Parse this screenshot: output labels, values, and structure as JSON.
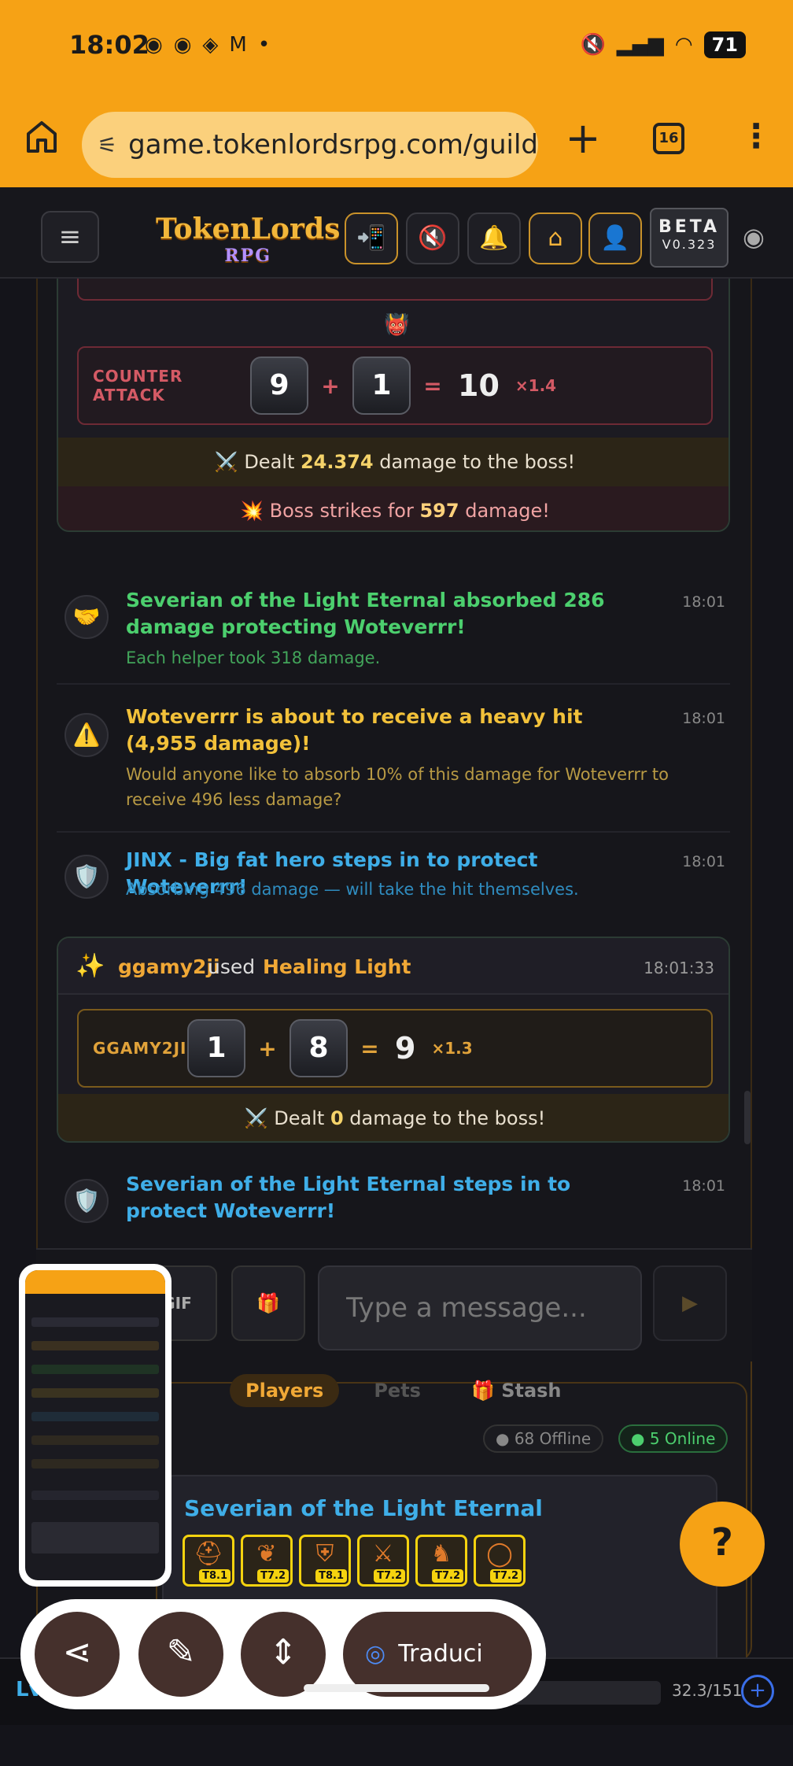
{
  "status": {
    "time": "18:02",
    "battery": "71"
  },
  "browser": {
    "url": "game.tokenlordsrpg.com/guilds",
    "tab_count": "16"
  },
  "header": {
    "logo_top": "TokenLords",
    "logo_bottom": "RPG",
    "beta_label": "BETA",
    "version": "V0.323"
  },
  "chat": {
    "attack_card": {
      "roll_label": "COUNTER ATTACK",
      "die1": "9",
      "die2": "1",
      "plus": "+",
      "equals": "=",
      "total": "10",
      "multiplier": "×1.4",
      "dealt_prefix": "⚔️ Dealt ",
      "dealt_value": "24.374",
      "dealt_suffix": " damage to the boss!",
      "boss_prefix": "💥 Boss strikes for ",
      "boss_value": "597",
      "boss_suffix": " damage!"
    },
    "messages": [
      {
        "title": "Severian of the Light Eternal absorbed 286 damage protecting Woteverrr!",
        "sub": "Each helper took 318 damage.",
        "time": "18:01"
      },
      {
        "title": "Woteverrr is about to receive a heavy hit (4,955 damage)!",
        "sub": "Would anyone like to absorb 10% of this damage for Woteverrr to receive 496 less damage?",
        "time": "18:01"
      },
      {
        "title": "JINX - Big fat hero steps in to protect Woteverrr!",
        "sub": "Absorbing 496 damage — will take the hit themselves.",
        "time": "18:01"
      }
    ],
    "skill_card": {
      "user": "ggamy2ji",
      "used": "used",
      "skill": "Healing Light",
      "time": "18:01:33",
      "roll_label": "GGAMY2JI",
      "die1": "1",
      "die2": "8",
      "plus": "+",
      "equals": "=",
      "total": "9",
      "multiplier": "×1.3",
      "dealt_prefix": "⚔️ Dealt ",
      "dealt_value": "0",
      "dealt_suffix": " damage to the boss!"
    },
    "last_message": {
      "title": "Severian of the Light Eternal steps in to protect Woteverrr!",
      "time": "18:01"
    },
    "input": {
      "gif_label": "GIF",
      "placeholder": "Type a message..."
    }
  },
  "panel": {
    "tabs": [
      "Players",
      "Pets",
      "🎁 Stash"
    ],
    "offline": "68 Offline",
    "online": "5 Online",
    "player_name": "Severian of the Light Eternal",
    "equipment": [
      {
        "icon": "helmet-icon",
        "tier": "T8.1"
      },
      {
        "icon": "amulet-icon",
        "tier": "T7.2"
      },
      {
        "icon": "armor-icon",
        "tier": "T8.1"
      },
      {
        "icon": "sword-icon",
        "tier": "T7.2"
      },
      {
        "icon": "boots-icon",
        "tier": "T7.2"
      },
      {
        "icon": "ring-icon",
        "tier": "T7.2"
      }
    ],
    "help": "?"
  },
  "bottom": {
    "level_prefix": "Lv",
    "xp": "32.3/151",
    "add": "+"
  },
  "toolbar": {
    "translate_label": "Traduci"
  }
}
